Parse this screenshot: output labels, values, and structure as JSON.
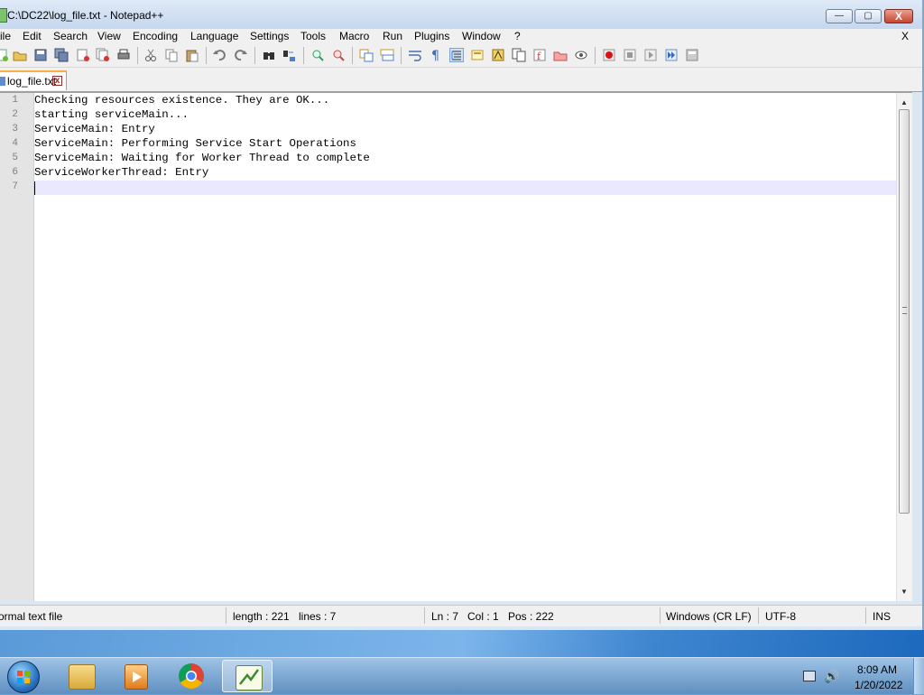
{
  "window": {
    "title": "C:\\DC22\\log_file.txt - Notepad++"
  },
  "window_controls": {
    "minimize": "—",
    "maximize": "▢",
    "close": "X"
  },
  "menu": {
    "items": [
      "ile",
      "Edit",
      "Search",
      "View",
      "Encoding",
      "Language",
      "Settings",
      "Tools",
      "Macro",
      "Run",
      "Plugins",
      "Window",
      "?"
    ],
    "close_doc": "X"
  },
  "tab": {
    "label": "log_file.txt",
    "close": "x"
  },
  "editor": {
    "line_numbers": [
      "1",
      "2",
      "3",
      "4",
      "5",
      "6",
      "7"
    ],
    "lines": [
      "Checking resources existence. They are OK...",
      "starting serviceMain...",
      "ServiceMain: Entry",
      "ServiceMain: Performing Service Start Operations",
      "ServiceMain: Waiting for Worker Thread to complete",
      "ServiceWorkerThread: Entry",
      ""
    ]
  },
  "scrollbar": {
    "up": "▲",
    "down": "▼"
  },
  "status": {
    "file_type": "ormal text file",
    "length": "length : 221",
    "lines": "lines : 7",
    "ln": "Ln : 7",
    "col": "Col : 1",
    "pos": "Pos : 222",
    "eol": "Windows (CR LF)",
    "encoding": "UTF-8",
    "mode": "INS"
  },
  "taskbar": {
    "clock_time": "8:09 AM",
    "clock_date": "1/20/2022",
    "volume_icon": "🔊"
  },
  "colors": {
    "tab_accent": "#f7b046",
    "current_line": "#e8e8ff",
    "gutter": "#e4e4e4"
  }
}
